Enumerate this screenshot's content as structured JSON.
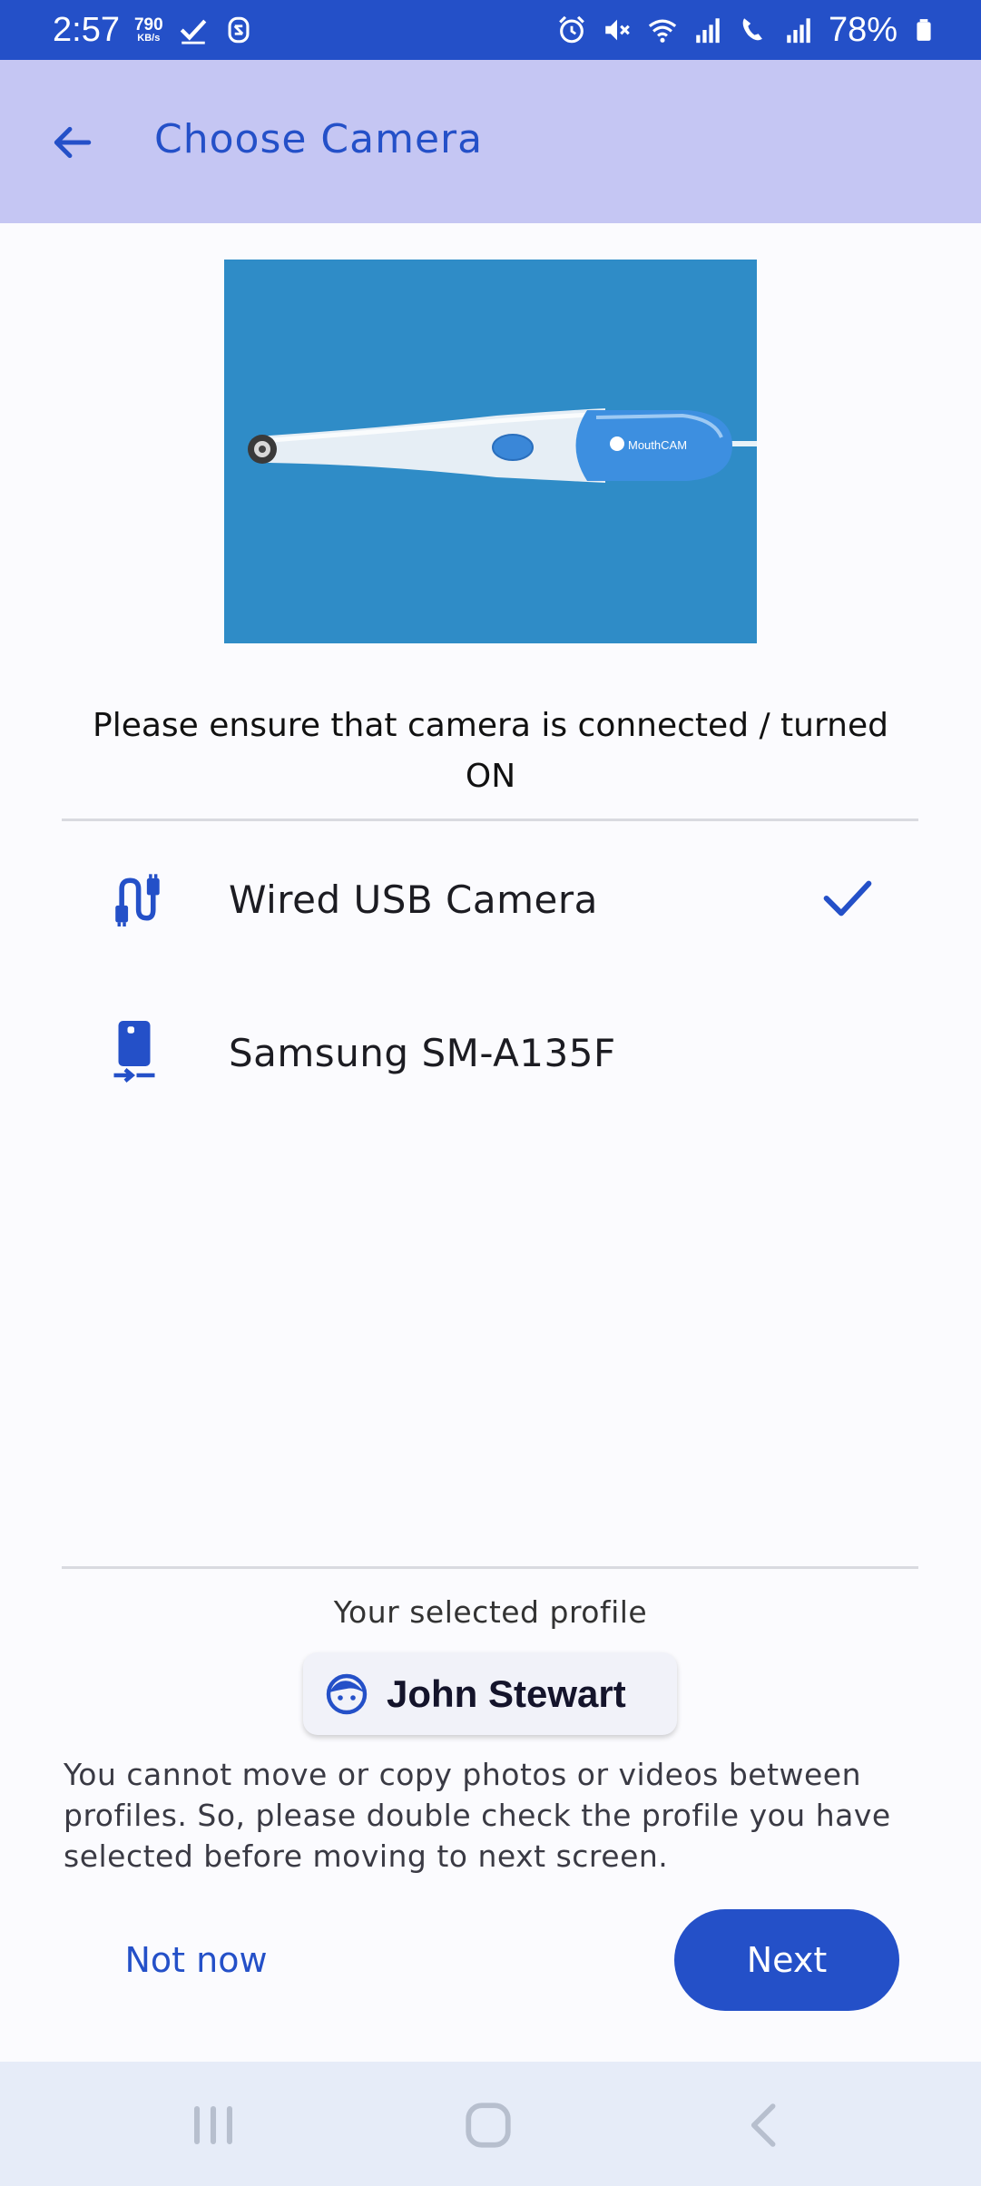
{
  "status_bar": {
    "time": "2:57",
    "speed_value": "790",
    "speed_unit": "KB/s",
    "battery": "78%",
    "icons": [
      "check-icon",
      "s-icon",
      "alarm-icon",
      "mute-icon",
      "wifi-icon",
      "signal-icon",
      "volte-icon",
      "signal-icon",
      "battery-icon"
    ]
  },
  "app_bar": {
    "title": "Choose Camera"
  },
  "instruction": "Please ensure that camera is connected / turned ON",
  "cameras": [
    {
      "label": "Wired USB Camera",
      "icon": "usb-cable-icon",
      "selected": true
    },
    {
      "label": "Samsung SM-A135F",
      "icon": "phone-camera-icon",
      "selected": false
    }
  ],
  "hero": {
    "brand": "MouthCAM"
  },
  "profile": {
    "caption": "Your selected profile",
    "name": "John Stewart"
  },
  "warning": "You cannot move or copy photos or videos between profiles. So, please double check the profile you have selected before moving to next screen.",
  "actions": {
    "not_now": "Not now",
    "next": "Next"
  },
  "colors": {
    "primary": "#2450c8",
    "app_bar_bg": "#c5c6f3",
    "hero_bg": "#2f8cc7",
    "nav_bg": "#e6ecf8"
  }
}
